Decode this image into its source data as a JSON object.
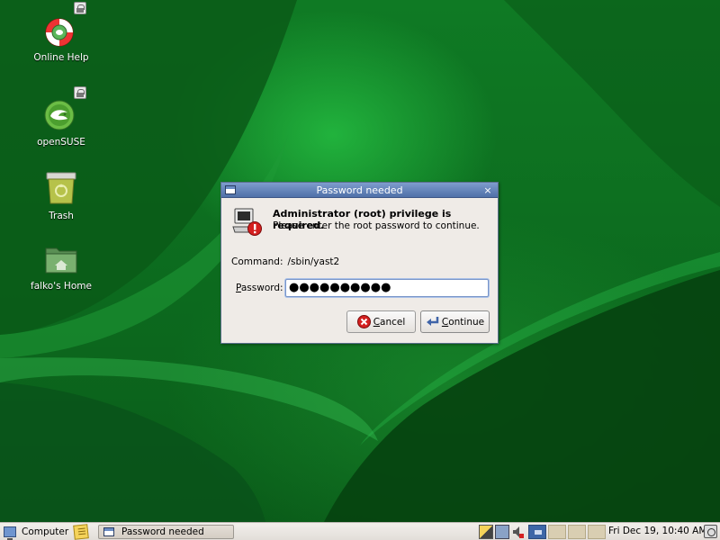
{
  "desktop": {
    "icons": [
      {
        "label": "Online Help",
        "icon": "lifebuoy-icon",
        "locked": true
      },
      {
        "label": "openSUSE",
        "icon": "opensuse-logo-icon",
        "locked": true
      },
      {
        "label": "Trash",
        "icon": "trash-icon",
        "locked": false
      },
      {
        "label": "falko's Home",
        "icon": "home-folder-icon",
        "locked": false
      }
    ]
  },
  "dialog": {
    "title": "Password needed",
    "close_glyph": "×",
    "headline": "Administrator (root) privilege is required.",
    "subline": "Please enter the root password to continue.",
    "command_label": "Command:",
    "command_value": "/sbin/yast2",
    "password_label_accel": "P",
    "password_label_rest": "assword:",
    "password_value": "●●●●●●●●●●",
    "cancel_accel": "C",
    "cancel_rest": "ancel",
    "continue_accel": "C",
    "continue_rest": "ontinue"
  },
  "taskbar": {
    "computer_label": "Computer",
    "task_label": "Password needed",
    "clock": "Fri Dec 19, 10:40 AM"
  },
  "colors": {
    "desktop_green": "#0d6f20",
    "titlebar_blue": "#4f70a8",
    "dialog_bg": "#efebe7",
    "error_red": "#d42020"
  }
}
